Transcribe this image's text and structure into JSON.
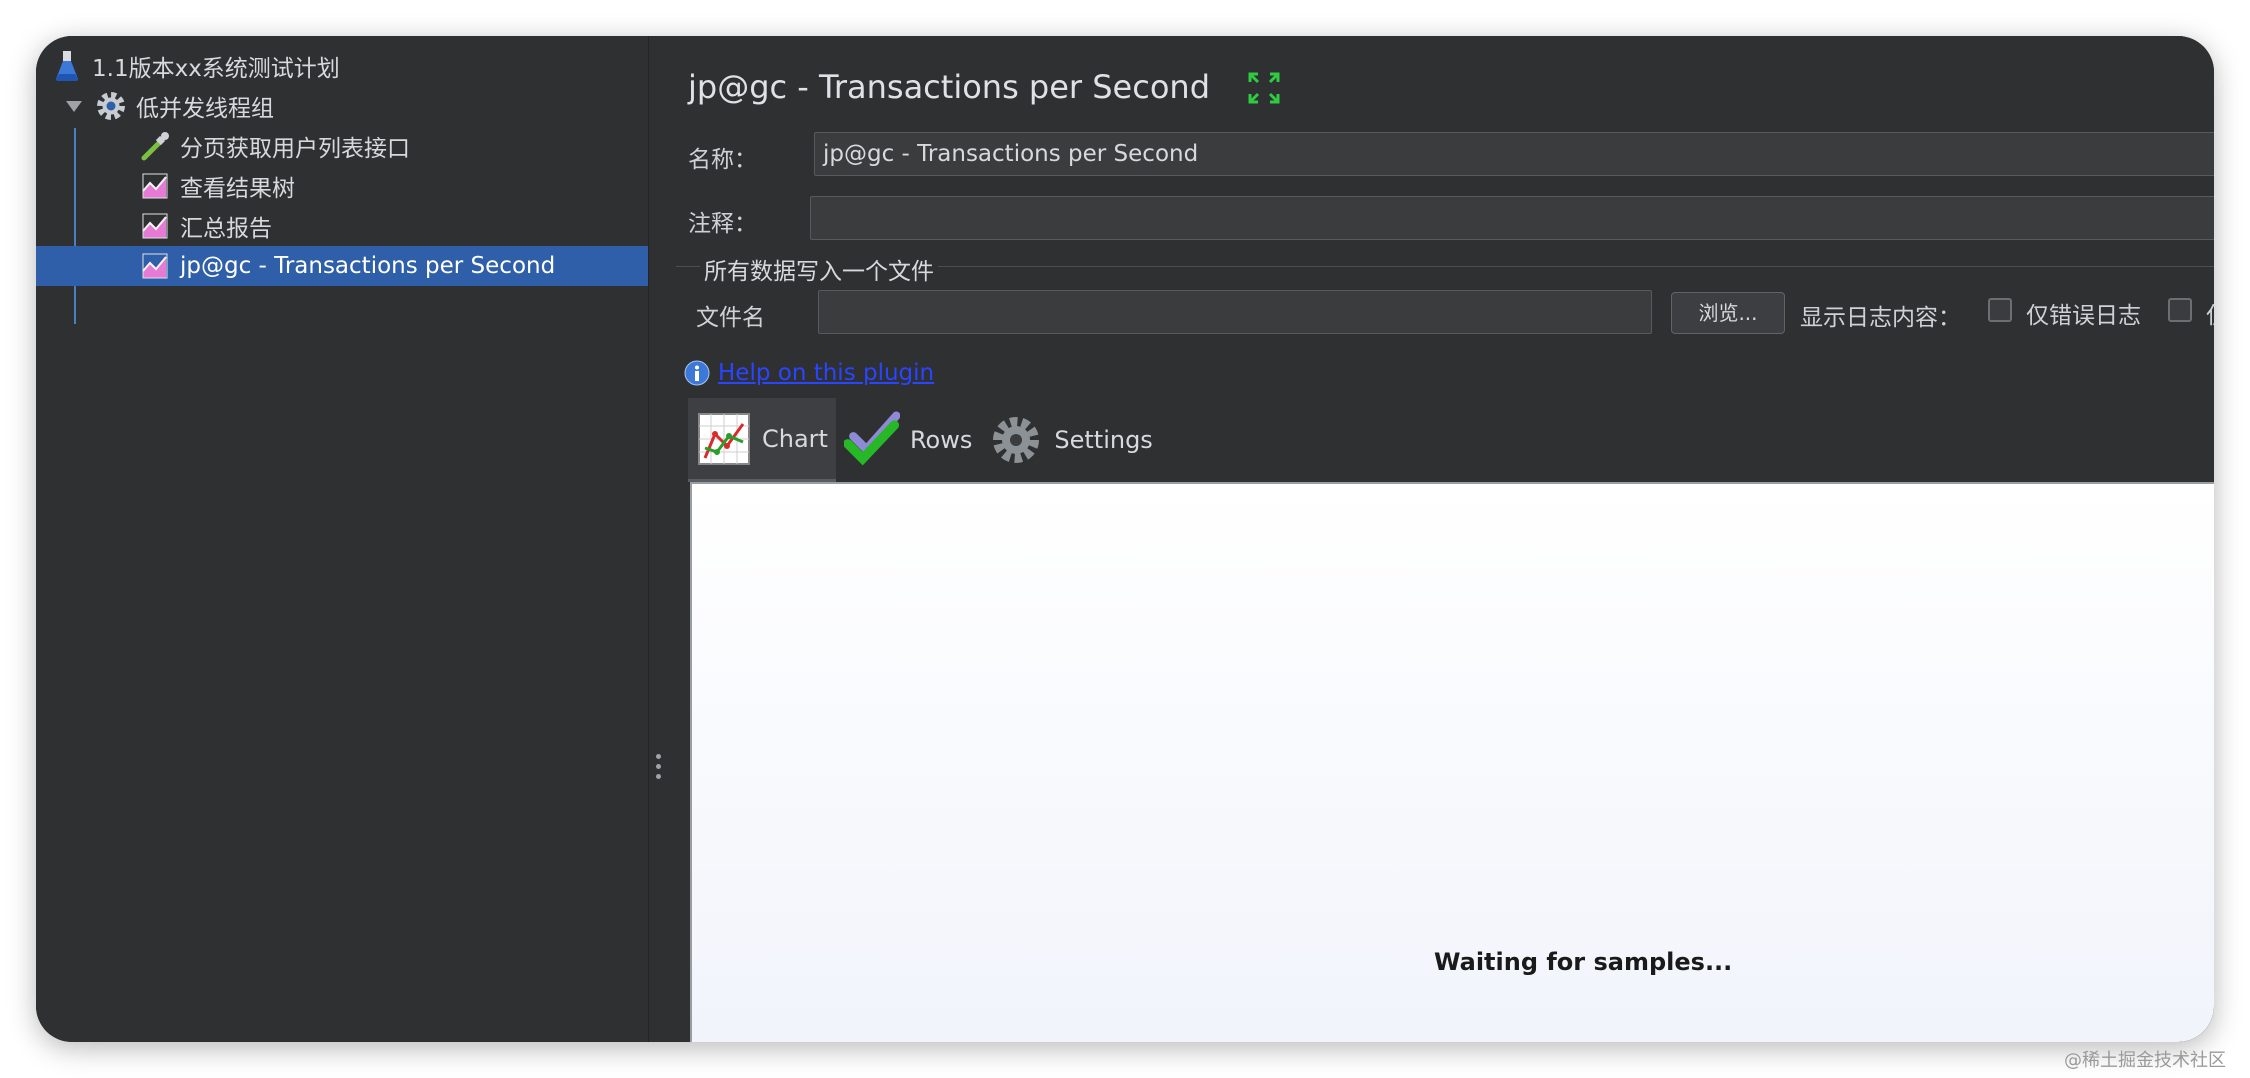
{
  "tree": {
    "items": [
      {
        "label": "1.1版本xx系统测试计划",
        "icon": "flask-icon"
      },
      {
        "label": "低并发线程组",
        "icon": "gear-icon"
      },
      {
        "label": "分页获取用户列表接口",
        "icon": "pipette-icon"
      },
      {
        "label": "查看结果树",
        "icon": "chart-icon"
      },
      {
        "label": "汇总报告",
        "icon": "chart-icon"
      },
      {
        "label": "jp@gc - Transactions per Second",
        "icon": "chart-icon",
        "selected": true
      }
    ]
  },
  "panel": {
    "title": "jp@gc - Transactions per Second",
    "name_label": "名称：",
    "name_value": "jp@gc - Transactions per Second",
    "comment_label": "注释：",
    "comment_value": "",
    "group_title": "所有数据写入一个文件",
    "filename_label": "文件名",
    "filename_value": "",
    "browse_label": "浏览...",
    "log_label": "显示日志内容：",
    "errors_only_label": "仅错误日志",
    "success_only_label": "仅成",
    "help_link": "Help on this plugin"
  },
  "tabs": [
    {
      "label": "Chart",
      "icon": "chart-icon",
      "active": true
    },
    {
      "label": "Rows",
      "icon": "checkmark-icon"
    },
    {
      "label": "Settings",
      "icon": "gear-icon"
    }
  ],
  "chart": {
    "status_text": "Waiting for samples..."
  },
  "watermark": "@稀土掘金技术社区",
  "colors": {
    "background": "#2f3032",
    "selection": "#2f5fa8",
    "link": "#2a45ff"
  }
}
